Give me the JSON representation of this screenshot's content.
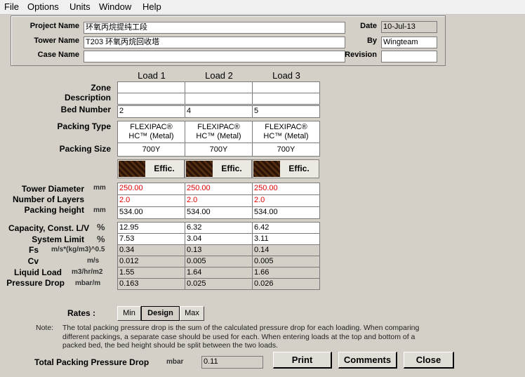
{
  "menu": [
    "File",
    "Options",
    "Units",
    "Window",
    "Help"
  ],
  "header": {
    "project_name_label": "Project Name",
    "project_name": "环氧丙烷提纯工段",
    "tower_name_label": "Tower Name",
    "tower_name": "T203 环氧丙烷回收塔",
    "case_name_label": "Case Name",
    "case_name": "",
    "date_label": "Date",
    "date": "10-Jul-13",
    "by_label": "By",
    "by": "Wingteam",
    "revision_label": "Revision",
    "revision": ""
  },
  "loads": {
    "headers": [
      "Load 1",
      "Load 2",
      "Load 3"
    ],
    "row_labels": {
      "zone": "Zone",
      "description": "Description",
      "bed_number": "Bed Number",
      "packing_type": "Packing Type",
      "packing_size": "Packing Size"
    },
    "bed_number": [
      "2",
      "4",
      "5"
    ],
    "packing_type_line1": [
      "FLEXIPAC®",
      "FLEXIPAC®",
      "FLEXIPAC®"
    ],
    "packing_type_line2": [
      "HC™ (Metal)",
      "HC™ (Metal)",
      "HC™ (Metal)"
    ],
    "packing_size": [
      "700Y",
      "700Y",
      "700Y"
    ],
    "effic_label": "Effic."
  },
  "geometry": {
    "labels": {
      "diameter": "Tower Diameter",
      "layers": "Number of Layers",
      "height": "Packing height"
    },
    "units": {
      "diameter": "mm",
      "height": "mm"
    },
    "diameter": [
      "250.00",
      "250.00",
      "250.00"
    ],
    "layers": [
      "2.0",
      "2.0",
      "2.0"
    ],
    "height": [
      "534.00",
      "534.00",
      "534.00"
    ]
  },
  "results": {
    "labels": {
      "capacity": "Capacity, Const. L/V",
      "system_limit": "System Limit",
      "fs": "Fs",
      "cv": "Cv",
      "liquid_load": "Liquid Load",
      "pressure_drop": "Pressure Drop"
    },
    "units": {
      "capacity": "%",
      "system_limit": "%",
      "fs": "m/s*(kg/m3)^0.5",
      "cv": "m/s",
      "liquid_load": "m3/hr/m2",
      "pressure_drop": "mbar/m"
    },
    "capacity": [
      "12.95",
      "6.32",
      "6.42"
    ],
    "system_limit": [
      "7.53",
      "3.04",
      "3.11"
    ],
    "fs": [
      "0.34",
      "0.13",
      "0.14"
    ],
    "cv": [
      "0.012",
      "0.005",
      "0.005"
    ],
    "liquid_load": [
      "1.55",
      "1.64",
      "1.66"
    ],
    "pressure_drop": [
      "0.163",
      "0.025",
      "0.026"
    ]
  },
  "rates": {
    "label": "Rates :",
    "min": "Min",
    "design": "Design",
    "max": "Max"
  },
  "note": {
    "label": "Note:",
    "line1": "The total packing pressure drop is the sum of the calculated pressure drop for each loading.  When comparing",
    "line2": "different packings, a separate case should be used for each.  When entering loads at the top and bottom of a",
    "line3": "packed bed, the bed height should be split between the two loads."
  },
  "footer": {
    "total_label": "Total Packing Pressure Drop",
    "unit": "mbar",
    "total": "0.11",
    "print": "Print",
    "comments": "Comments",
    "close": "Close"
  },
  "colors": {
    "background": "#d4d0c8",
    "red_value": "#e00000"
  }
}
